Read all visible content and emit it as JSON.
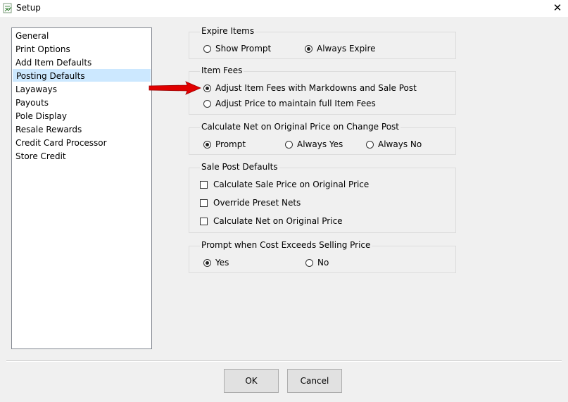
{
  "window": {
    "title": "Setup",
    "app_icon": "setup-app-icon",
    "close_label": "✕"
  },
  "sidebar": {
    "items": [
      {
        "label": "General"
      },
      {
        "label": "Print Options"
      },
      {
        "label": "Add Item Defaults"
      },
      {
        "label": "Posting Defaults",
        "selected": true
      },
      {
        "label": "Layaways"
      },
      {
        "label": "Payouts"
      },
      {
        "label": "Pole Display"
      },
      {
        "label": "Resale Rewards"
      },
      {
        "label": "Credit Card Processor"
      },
      {
        "label": "Store Credit"
      }
    ]
  },
  "expire_items": {
    "title": "Expire Items",
    "options": [
      {
        "label": "Show Prompt",
        "checked": false
      },
      {
        "label": "Always Expire",
        "checked": true
      }
    ]
  },
  "item_fees": {
    "title": "Item Fees",
    "options": [
      {
        "label": "Adjust Item Fees with Markdowns and Sale Post",
        "checked": true
      },
      {
        "label": "Adjust Price to maintain full Item Fees",
        "checked": false
      }
    ]
  },
  "calculate_net": {
    "title": "Calculate Net on Original Price on Change Post",
    "options": [
      {
        "label": "Prompt",
        "checked": true
      },
      {
        "label": "Always Yes",
        "checked": false
      },
      {
        "label": "Always No",
        "checked": false
      }
    ]
  },
  "sale_post_defaults": {
    "title": "Sale Post Defaults",
    "checkboxes": [
      {
        "label": "Calculate Sale Price on Original Price",
        "checked": false
      },
      {
        "label": "Override Preset Nets",
        "checked": false
      },
      {
        "label": "Calculate Net on Original Price",
        "checked": false
      }
    ]
  },
  "cost_exceeds": {
    "title": "Prompt when Cost Exceeds Selling Price",
    "options": [
      {
        "label": "Yes",
        "checked": true
      },
      {
        "label": "No",
        "checked": false
      }
    ]
  },
  "annotation": {
    "icon": "red-arrow-icon",
    "color": "#e00000"
  },
  "buttons": {
    "ok": "OK",
    "cancel": "Cancel"
  }
}
